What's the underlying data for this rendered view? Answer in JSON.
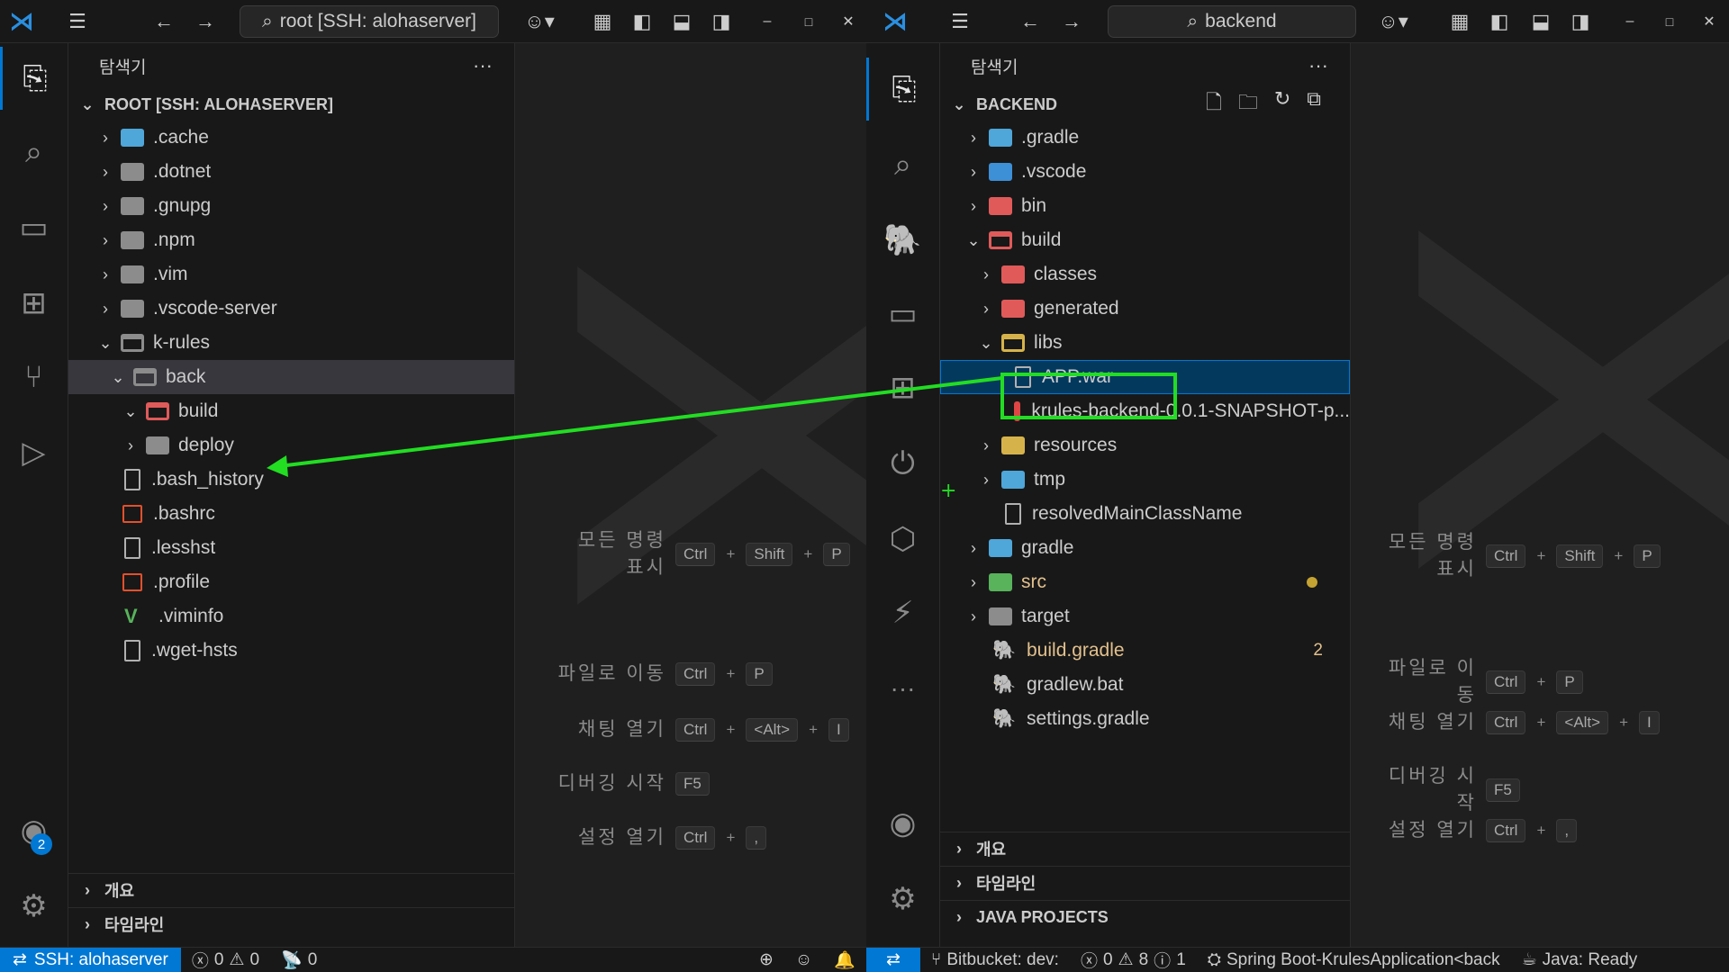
{
  "left": {
    "search": "root [SSH: alohaserver]",
    "explorer_title": "탐색기",
    "root_label": "ROOT [SSH: ALOHASERVER]",
    "tree": [
      {
        "label": ".cache"
      },
      {
        "label": ".dotnet"
      },
      {
        "label": ".gnupg"
      },
      {
        "label": ".npm"
      },
      {
        "label": ".vim"
      },
      {
        "label": ".vscode-server"
      },
      {
        "label": "k-rules"
      },
      {
        "label": "back"
      },
      {
        "label": "build"
      },
      {
        "label": "deploy"
      },
      {
        "label": ".bash_history"
      },
      {
        "label": ".bashrc"
      },
      {
        "label": ".lesshst"
      },
      {
        "label": ".profile"
      },
      {
        "label": ".viminfo"
      },
      {
        "label": ".wget-hsts"
      }
    ],
    "outline": "개요",
    "timeline": "타임라인",
    "accounts_badge": "2",
    "status": {
      "remote": "SSH: alohaserver",
      "errors": "0",
      "warnings": "0",
      "ports": "0"
    }
  },
  "right": {
    "search": "backend",
    "explorer_title": "탐색기",
    "root_label": "BACKEND",
    "tree": [
      {
        "label": ".gradle"
      },
      {
        "label": ".vscode"
      },
      {
        "label": "bin"
      },
      {
        "label": "build"
      },
      {
        "label": "classes"
      },
      {
        "label": "generated"
      },
      {
        "label": "libs"
      },
      {
        "label": "APP.war"
      },
      {
        "label": "krules-backend-0.0.1-SNAPSHOT-p..."
      },
      {
        "label": "resources"
      },
      {
        "label": "tmp"
      },
      {
        "label": "resolvedMainClassName"
      },
      {
        "label": "gradle"
      },
      {
        "label": "src"
      },
      {
        "label": "target"
      },
      {
        "label": "build.gradle",
        "count": "2"
      },
      {
        "label": "gradlew.bat"
      },
      {
        "label": "settings.gradle"
      }
    ],
    "outline": "개요",
    "timeline": "타임라인",
    "java_projects": "JAVA PROJECTS",
    "status": {
      "bitbucket": "Bitbucket: dev:",
      "errors": "0",
      "warnings": "8",
      "info": "1",
      "spring": "Spring Boot-KrulesApplication<back",
      "java": "Java: Ready"
    }
  },
  "shortcuts": {
    "show_all_commands": "모든 명령 표시",
    "go_to_file": "파일로 이동",
    "open_chat": "채팅 열기",
    "start_debugging": "디버깅 시작",
    "open_settings": "설정 열기",
    "keys": {
      "ctrl": "Ctrl",
      "shift": "Shift",
      "p": "P",
      "alt": "<Alt>",
      "i": "I",
      "f5": "F5",
      "comma": ","
    }
  },
  "colors": {
    "accent": "#0078d4",
    "annotation": "#22dd22",
    "folder_red": "#e05a5a",
    "folder_blue": "#4fa6d9",
    "folder_yellow": "#d6b34a",
    "folder_green": "#58b35b"
  }
}
